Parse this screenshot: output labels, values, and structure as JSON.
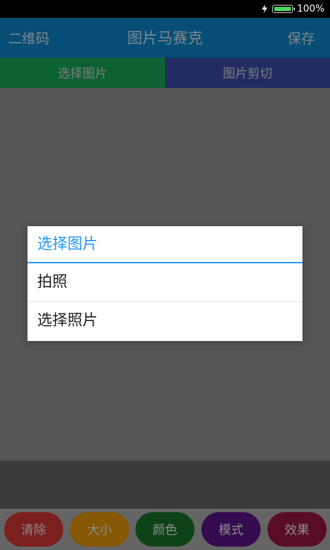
{
  "status_bar": {
    "battery_text": "100%",
    "battery_level": 1.0,
    "icons": [
      "charging-bolt-icon",
      "battery-icon"
    ]
  },
  "app_bar": {
    "left_button": "二维码",
    "title": "图片马赛克",
    "right_button": "保存"
  },
  "tabs": [
    {
      "label": "选择图片",
      "color": "#16b25b"
    },
    {
      "label": "图片剪切",
      "color": "#3f51b5"
    }
  ],
  "dialog": {
    "title": "选择图片",
    "accent": "#2196f3",
    "items": [
      {
        "label": "拍照"
      },
      {
        "label": "选择照片"
      }
    ]
  },
  "toolbar": {
    "buttons": [
      {
        "label": "清除",
        "color": "#e23a3a"
      },
      {
        "label": "大小",
        "color": "#f5a10a"
      },
      {
        "label": "颜色",
        "color": "#1b7a2b"
      },
      {
        "label": "模式",
        "color": "#5e148f"
      },
      {
        "label": "效果",
        "color": "#a3174a"
      }
    ]
  }
}
